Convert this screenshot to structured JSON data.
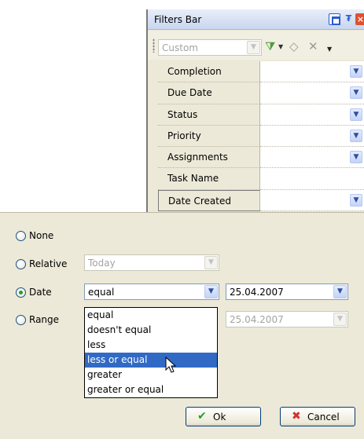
{
  "filters_bar": {
    "title": "Filters Bar",
    "preset_value": "Custom",
    "fields": [
      "Completion",
      "Due Date",
      "Status",
      "Priority",
      "Assignments",
      "Task Name",
      "Date Created"
    ]
  },
  "dialog": {
    "options": {
      "none": "None",
      "relative": "Relative",
      "date": "Date",
      "range": "Range"
    },
    "selected_option": "Date",
    "relative_value": "Today",
    "date_operator": "equal",
    "date_value": "25.04.2007",
    "range_value": "25.04.2007",
    "operator_options": [
      "equal",
      "doesn't equal",
      "less",
      "less or equal",
      "greater",
      "greater or equal"
    ],
    "highlighted_option": "less or equal",
    "ok_label": "Ok",
    "cancel_label": "Cancel"
  },
  "icons": {
    "restore": "restore-icon",
    "pin": "pin-icon",
    "close": "close-icon",
    "filter": "filter-icon",
    "eraser": "eraser-icon",
    "clear": "clear-icon",
    "ok": "checkmark-icon",
    "cancel": "x-icon"
  },
  "colors": {
    "selection": "#316ac5",
    "ok_check": "#21a121",
    "cancel_x": "#d2322d"
  }
}
